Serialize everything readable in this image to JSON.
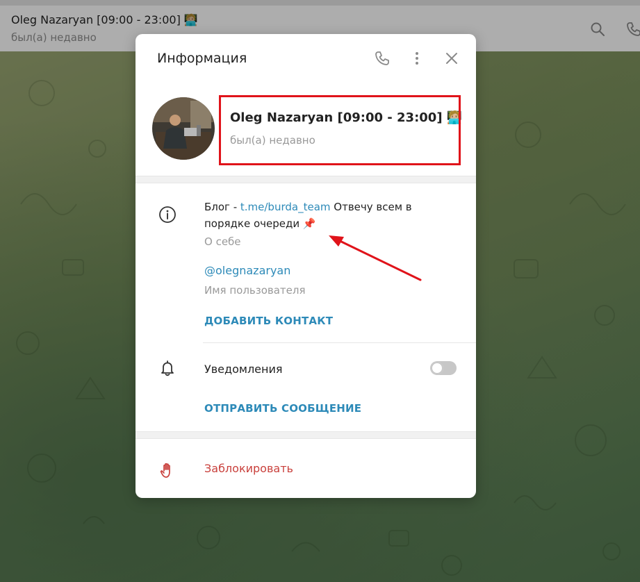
{
  "chat_header": {
    "title": "Oleg Nazaryan [09:00 - 23:00] 🧑🏼‍💻",
    "status": "был(а) недавно",
    "icons": [
      "search-icon",
      "phone-icon"
    ]
  },
  "modal": {
    "title": "Информация",
    "header_icons": [
      "phone-icon",
      "more-vertical-icon",
      "close-icon"
    ],
    "profile": {
      "name": "Oleg Nazaryan [09:00 - 23:00] 🧑🏼‍💻",
      "status": "был(а) недавно"
    },
    "bio": {
      "prefix": "Блог - ",
      "link": "t.me/burda_team",
      "suffix": " Отвечу всем в порядке очереди 📌",
      "label": "О себе"
    },
    "username": {
      "value": "@olegnazaryan",
      "label": "Имя пользователя"
    },
    "add_contact_label": "ДОБАВИТЬ КОНТАКТ",
    "notifications": {
      "label": "Уведомления",
      "enabled": false
    },
    "send_message_label": "ОТПРАВИТЬ СООБЩЕНИЕ",
    "block_label": "Заблокировать"
  },
  "colors": {
    "accent": "#2d8ab8",
    "danger": "#c9403c",
    "highlight": "#e0131a"
  }
}
